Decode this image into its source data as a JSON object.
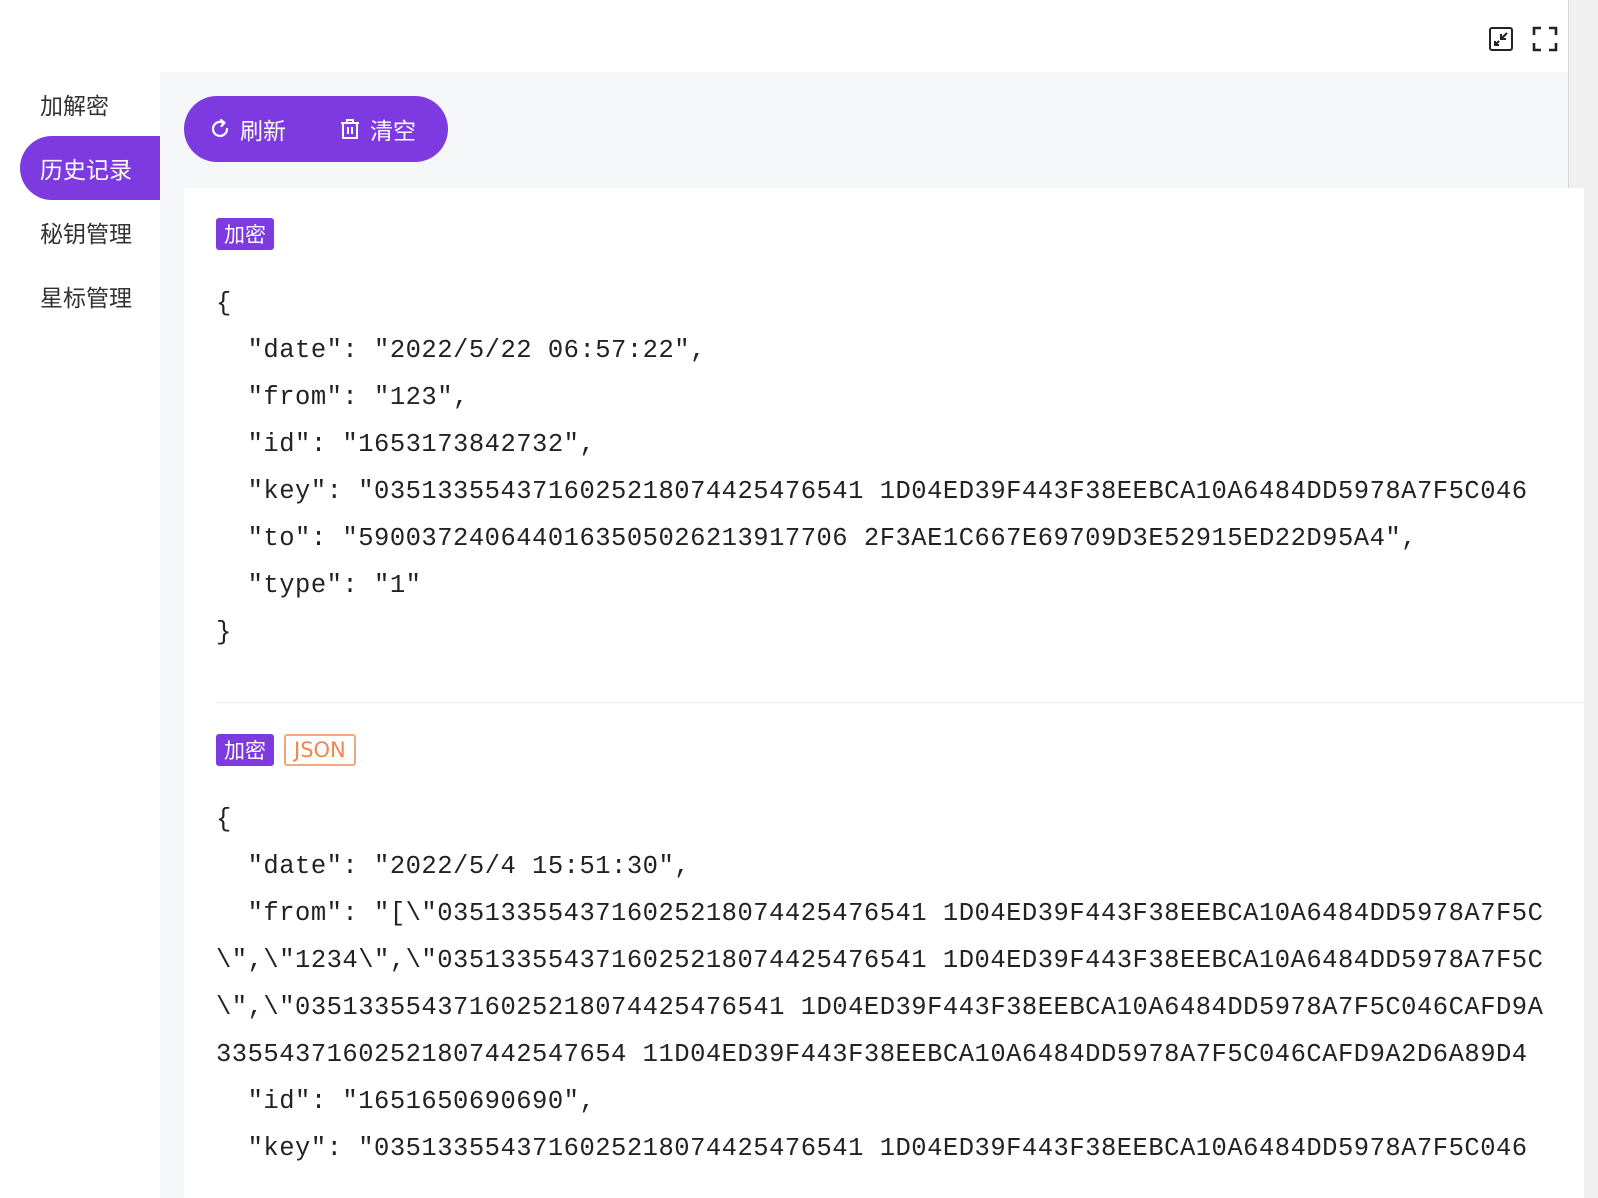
{
  "window": {
    "controls": [
      {
        "name": "restore-icon"
      },
      {
        "name": "fullscreen-icon"
      }
    ]
  },
  "sidebar": {
    "items": [
      {
        "label": "加解密",
        "active": false
      },
      {
        "label": "历史记录",
        "active": true
      },
      {
        "label": "秘钥管理",
        "active": false
      },
      {
        "label": "星标管理",
        "active": false
      }
    ]
  },
  "toolbar": {
    "refresh_label": "刷新",
    "refresh_icon": "refresh-icon",
    "clear_label": "清空",
    "clear_icon": "trash-icon"
  },
  "records": [
    {
      "tags": [
        "加密"
      ],
      "lines": [
        "{",
        "  \"date\": \"2022/5/22 06:57:22\",",
        "  \"from\": \"123\",",
        "  \"id\": \"1653173842732\",",
        "  \"key\": \"0351335543716025218074425476541 1D04ED39F443F38EEBCA10A6484DD5978A7F5C046",
        "  \"to\": \"5900372406440163505026213917706 2F3AE1C667E69709D3E52915ED22D95A4\",",
        "  \"type\": \"1\"",
        "}"
      ]
    },
    {
      "tags": [
        "加密",
        "JSON"
      ],
      "lines": [
        "{",
        "  \"date\": \"2022/5/4 15:51:30\",",
        "  \"from\": \"[\\\"0351335543716025218074425476541 1D04ED39F443F38EEBCA10A6484DD5978A7F5C",
        "\\\",\\\"1234\\\",\\\"0351335543716025218074425476541 1D04ED39F443F38EEBCA10A6484DD5978A7F5C",
        "\\\",\\\"0351335543716025218074425476541 1D04ED39F443F38EEBCA10A6484DD5978A7F5C046CAFD9A",
        "33554371602521807442547654 11D04ED39F443F38EEBCA10A6484DD5978A7F5C046CAFD9A2D6A89D4",
        "  \"id\": \"1651650690690\",",
        "  \"key\": \"0351335543716025218074425476541 1D04ED39F443F38EEBCA10A6484DD5978A7F5C046"
      ]
    }
  ],
  "colors": {
    "accent": "#7c3ae0",
    "json_tag": "#f0864d"
  }
}
